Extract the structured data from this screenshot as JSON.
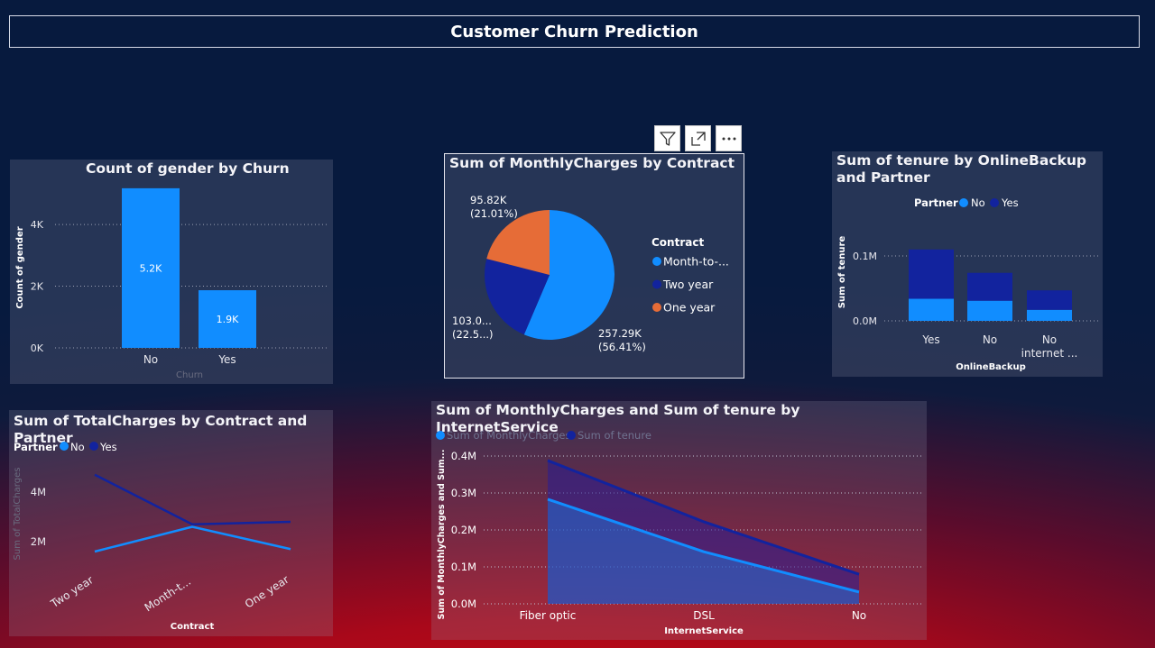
{
  "page": {
    "title": "Customer Churn Prediction"
  },
  "toolbar": {
    "filter_icon": "filter-icon",
    "focus_icon": "focus-mode-icon",
    "more_icon": "more-options-icon"
  },
  "colors": {
    "light_blue": "#118dff",
    "dark_blue": "#12239e",
    "orange": "#e66c37"
  },
  "visuals": {
    "gender_churn": {
      "title": "Count of gender by Churn"
    },
    "monthly_contract": {
      "title": "Sum of MonthlyCharges by Contract"
    },
    "tenure_backup": {
      "title": "Sum of tenure by OnlineBackup and Partner"
    },
    "totalcharges": {
      "title": "Sum of TotalCharges by Contract and Partner"
    },
    "internet": {
      "title": "Sum of MonthlyCharges and Sum of tenure by InternetService"
    }
  },
  "chart_data": [
    {
      "type": "bar",
      "title": "Count of gender by Churn",
      "xlabel": "Churn",
      "ylabel": "Count of gender",
      "categories": [
        "No",
        "Yes"
      ],
      "values": [
        5174,
        1869
      ],
      "data_labels": [
        "5.2K",
        "1.9K"
      ],
      "y_ticks": [
        "0K",
        "2K",
        "4K"
      ],
      "ylim": [
        0,
        5200
      ]
    },
    {
      "type": "pie",
      "title": "Sum of MonthlyCharges by Contract",
      "legend_title": "Contract",
      "legend_position": "right",
      "slices": [
        {
          "name": "Month-to-...",
          "value": 257.29,
          "label": "257.29K",
          "pct": "(56.41%)",
          "color": "#118dff"
        },
        {
          "name": "Two year",
          "value": 103.0,
          "label": "103.0...",
          "pct": "(22.5...)",
          "color": "#12239e"
        },
        {
          "name": "One year",
          "value": 95.82,
          "label": "95.82K",
          "pct": "(21.01%)",
          "color": "#e66c37"
        }
      ]
    },
    {
      "type": "bar",
      "stacked": true,
      "title": "Sum of tenure by OnlineBackup and Partner",
      "xlabel": "OnlineBackup",
      "ylabel": "Sum of tenure",
      "legend_title": "Partner",
      "legend_position": "top-left",
      "categories": [
        "Yes",
        "No",
        [
          "No",
          "internet ..."
        ]
      ],
      "series": [
        {
          "name": "No",
          "values": [
            0.034,
            0.031,
            0.017
          ],
          "color": "#118dff"
        },
        {
          "name": "Yes",
          "values": [
            0.076,
            0.043,
            0.03
          ],
          "color": "#12239e"
        }
      ],
      "y_ticks": [
        "0.0M",
        "0.1M"
      ],
      "ylim": [
        0,
        0.1
      ]
    },
    {
      "type": "line",
      "title": "Sum of TotalCharges by Contract and Partner",
      "xlabel": "Contract",
      "ylabel": "Sum of TotalCharges",
      "legend_title": "Partner",
      "legend_position": "top-left",
      "categories": [
        "Two year",
        "Month-t...",
        "One year"
      ],
      "series": [
        {
          "name": "No",
          "values": [
            1.6,
            2.6,
            1.7
          ],
          "color": "#118dff"
        },
        {
          "name": "Yes",
          "values": [
            4.7,
            2.7,
            2.8
          ],
          "color": "#12239e"
        }
      ],
      "y_ticks": [
        "2M",
        "4M"
      ],
      "ylim": [
        0,
        4
      ]
    },
    {
      "type": "area",
      "title": "Sum of MonthlyCharges and Sum of tenure by InternetService",
      "xlabel": "InternetService",
      "ylabel": "Sum of MonthlyCharges and Sum...",
      "legend_position": "top-left",
      "categories": [
        "Fiber optic",
        "DSL",
        "No"
      ],
      "series": [
        {
          "name": "Sum of MonthlyCharges",
          "values": [
            0.283,
            0.141,
            0.032
          ],
          "color": "#118dff"
        },
        {
          "name": "Sum of tenure",
          "values": [
            0.388,
            0.222,
            0.08
          ],
          "color": "#12239e"
        }
      ],
      "y_ticks": [
        "0.0M",
        "0.1M",
        "0.2M",
        "0.3M",
        "0.4M"
      ],
      "ylim": [
        0,
        0.4
      ]
    }
  ]
}
